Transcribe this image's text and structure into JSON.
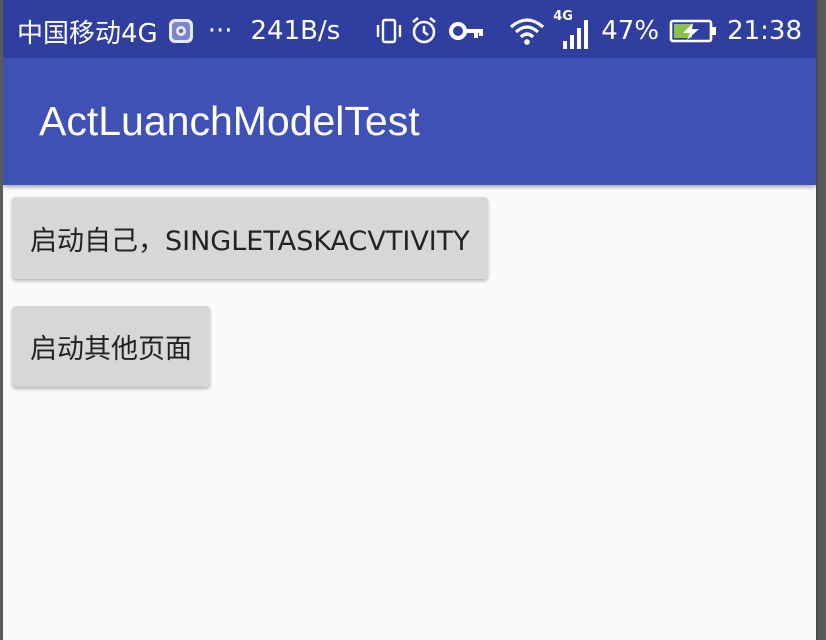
{
  "status_bar": {
    "carrier": "中国移动4G",
    "notification_more": "···",
    "net_speed": "241B/s",
    "network_type": "4G",
    "battery_percent": "47%",
    "time": "21:38",
    "icons": [
      "shield-app-icon",
      "vibrate-icon",
      "alarm-icon",
      "key-icon",
      "wifi-icon",
      "signal-icon",
      "battery-charging-icon"
    ]
  },
  "app_bar": {
    "title": "ActLuanchModelTest"
  },
  "buttons": [
    {
      "label": "启动自己，SINGLETASKACVTIVITY"
    },
    {
      "label": "启动其他页面"
    }
  ],
  "colors": {
    "status_bar": "#303f9f",
    "app_bar": "#3f51b5",
    "background": "#fafafa",
    "button": "#d6d7d7"
  }
}
